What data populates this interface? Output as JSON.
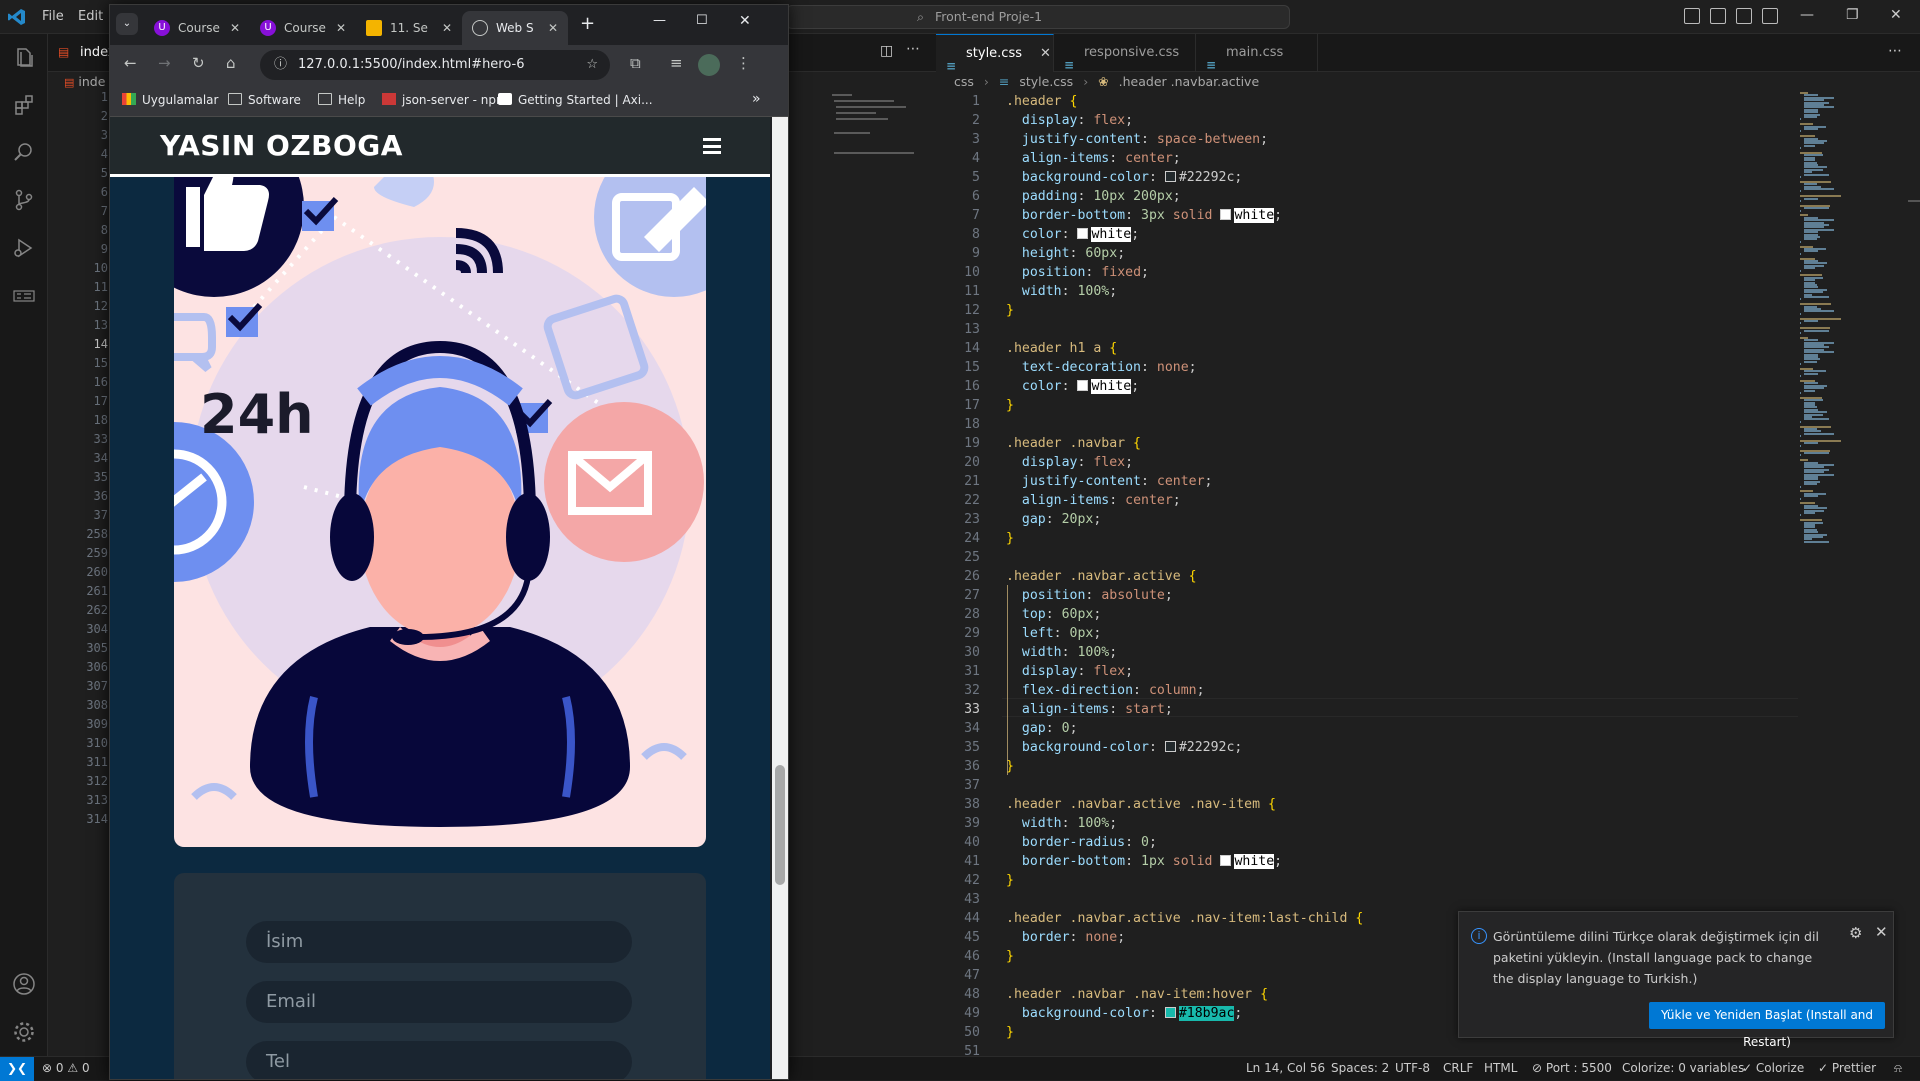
{
  "vscode": {
    "menu": [
      "File",
      "Edit"
    ],
    "command_center": "Front-end Proje-1",
    "left_group": {
      "tab_label": "index",
      "tab_label_2": "inde",
      "line_numbers": [
        "1",
        "2",
        "3",
        "4",
        "5",
        "6",
        "7",
        "8",
        "9",
        "10",
        "11",
        "12",
        "13",
        "14",
        "15",
        "16",
        "17",
        "18",
        "33",
        "34",
        "35",
        "36",
        "37",
        "258",
        "259",
        "260",
        "261",
        "262",
        "304",
        "305",
        "306",
        "307",
        "308",
        "309",
        "310",
        "311",
        "312",
        "313",
        "314"
      ],
      "current_line": "14"
    },
    "tabs": [
      {
        "label": "style.css",
        "active": true
      },
      {
        "label": "responsive.css",
        "active": false
      },
      {
        "label": "main.css",
        "active": false
      }
    ],
    "breadcrumb": [
      "css",
      "style.css",
      ".header .navbar.active"
    ],
    "code": {
      "current_line_number": 33,
      "lines": [
        [
          ".header {"
        ],
        [
          "  display: flex;"
        ],
        [
          "  justify-content: space-between;"
        ],
        [
          "  align-items: center;"
        ],
        [
          "  background-color: #22292c;"
        ],
        [
          "  padding: 10px 200px;"
        ],
        [
          "  border-bottom: 3px solid white;"
        ],
        [
          "  color: white;"
        ],
        [
          "  height: 60px;"
        ],
        [
          "  position: fixed;"
        ],
        [
          "  width: 100%;"
        ],
        [
          "}"
        ],
        [
          ""
        ],
        [
          ".header h1 a {"
        ],
        [
          "  text-decoration: none;"
        ],
        [
          "  color: white;"
        ],
        [
          "}"
        ],
        [
          ""
        ],
        [
          ".header .navbar {"
        ],
        [
          "  display: flex;"
        ],
        [
          "  justify-content: center;"
        ],
        [
          "  align-items: center;"
        ],
        [
          "  gap: 20px;"
        ],
        [
          "}"
        ],
        [
          ""
        ],
        [
          ".header .navbar.active {"
        ],
        [
          "  position: absolute;"
        ],
        [
          "  top: 60px;"
        ],
        [
          "  left: 0px;"
        ],
        [
          "  width: 100%;"
        ],
        [
          "  display: flex;"
        ],
        [
          "  flex-direction: column;"
        ],
        [
          "  align-items: start;"
        ],
        [
          "  gap: 0;"
        ],
        [
          "  background-color: #22292c;"
        ],
        [
          "}"
        ],
        [
          ""
        ],
        [
          ".header .navbar.active .nav-item {"
        ],
        [
          "  width: 100%;"
        ],
        [
          "  border-radius: 0;"
        ],
        [
          "  border-bottom: 1px solid white;"
        ],
        [
          "}"
        ],
        [
          ""
        ],
        [
          ".header .navbar.active .nav-item:last-child {"
        ],
        [
          "  border: none;"
        ],
        [
          "}"
        ],
        [
          ""
        ],
        [
          ".header .navbar .nav-item:hover {"
        ],
        [
          "  background-color: #18b9ac;"
        ],
        [
          "}"
        ],
        [
          ""
        ]
      ]
    },
    "notification": {
      "message": "Görüntüleme dilini Türkçe olarak değiştirmek için dil paketini yükleyin. (Install language pack to change the display language to Turkish.)",
      "button": "Yükle ve Yeniden Başlat (Install and Restart)"
    },
    "status": {
      "errors": "0",
      "warnings": "0",
      "position": "Ln 14, Col 56",
      "spaces": "Spaces: 2",
      "encoding": "UTF-8",
      "eol": "CRLF",
      "language": "HTML",
      "port": "Port : 5500",
      "colorize_vars": "Colorize: 0 variables",
      "colorize": "Colorize",
      "prettier": "Prettier"
    },
    "colors": {
      "accent": "#0078d4",
      "header_bg": "#22292c",
      "hover": "#18b9ac"
    }
  },
  "browser": {
    "tabs": [
      {
        "label": "Course",
        "icon": "udemy-icon",
        "active": false
      },
      {
        "label": "Course",
        "icon": "udemy-icon",
        "active": false
      },
      {
        "label": "11. Se",
        "icon": "slides-icon",
        "active": false
      },
      {
        "label": "Web S",
        "icon": "globe-icon",
        "active": true
      }
    ],
    "url": "127.0.0.1:5500/index.html#hero-6",
    "bookmarks": [
      "Uygulamalar",
      "Software",
      "Help",
      "json-server - npm",
      "Getting Started | Axi..."
    ],
    "page": {
      "logo": "YASIN OZBOGA",
      "hero_label": "24h",
      "fields": [
        "İsim",
        "Email",
        "Tel"
      ]
    }
  }
}
